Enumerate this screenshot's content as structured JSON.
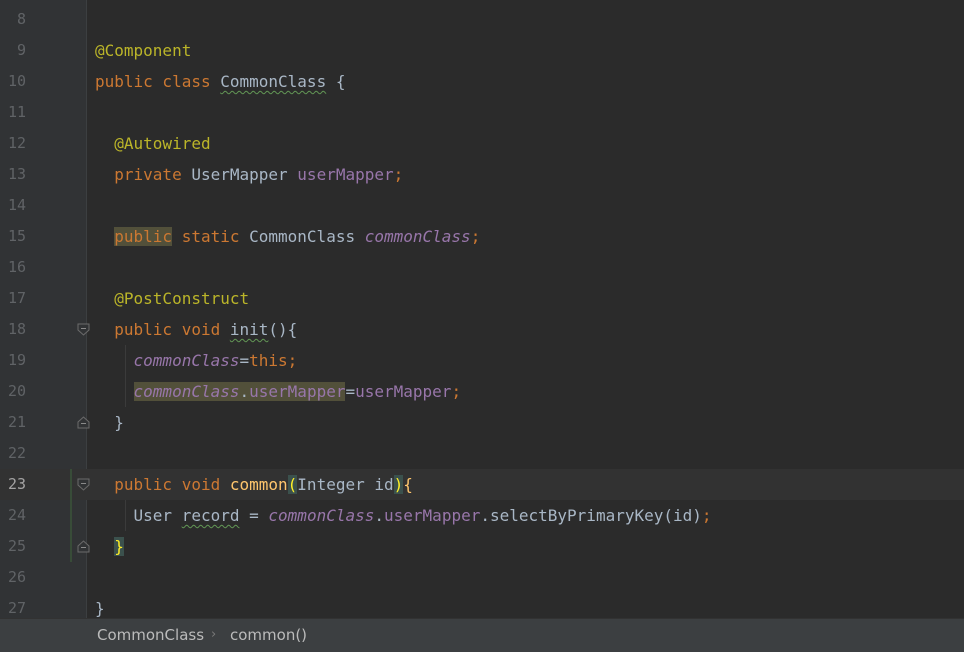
{
  "editor": {
    "lines": [
      {
        "n": "8",
        "tokens": []
      },
      {
        "n": "9",
        "tokens": [
          {
            "t": "@Component",
            "c": "ann"
          }
        ]
      },
      {
        "n": "10",
        "tokens": [
          {
            "t": "public class ",
            "c": "kw"
          },
          {
            "t": "CommonClass",
            "c": "typo"
          },
          {
            "t": " {",
            "c": ""
          }
        ]
      },
      {
        "n": "11",
        "tokens": []
      },
      {
        "n": "12",
        "tokens": [
          {
            "t": "  ",
            "c": ""
          },
          {
            "t": "@Autowired",
            "c": "ann"
          }
        ]
      },
      {
        "n": "13",
        "tokens": [
          {
            "t": "  ",
            "c": ""
          },
          {
            "t": "private ",
            "c": "kw"
          },
          {
            "t": "UserMapper ",
            "c": ""
          },
          {
            "t": "userMapper",
            "c": "fld"
          },
          {
            "t": ";",
            "c": "pun"
          }
        ]
      },
      {
        "n": "14",
        "tokens": []
      },
      {
        "n": "15",
        "tokens": [
          {
            "t": "  ",
            "c": ""
          },
          {
            "t": "public",
            "c": "kw hl-usage"
          },
          {
            "t": " static ",
            "c": "kw"
          },
          {
            "t": "CommonClass ",
            "c": ""
          },
          {
            "t": "commonClass",
            "c": "sfld"
          },
          {
            "t": ";",
            "c": "pun"
          }
        ]
      },
      {
        "n": "16",
        "tokens": []
      },
      {
        "n": "17",
        "tokens": [
          {
            "t": "  ",
            "c": ""
          },
          {
            "t": "@PostConstruct",
            "c": "ann"
          }
        ]
      },
      {
        "n": "18",
        "tokens": [
          {
            "t": "  ",
            "c": ""
          },
          {
            "t": "public void ",
            "c": "kw"
          },
          {
            "t": "init",
            "c": "typo"
          },
          {
            "t": "(){",
            "c": ""
          }
        ]
      },
      {
        "n": "19",
        "tokens": [
          {
            "t": "    ",
            "c": ""
          },
          {
            "t": "commonClass",
            "c": "sfld"
          },
          {
            "t": "=",
            "c": ""
          },
          {
            "t": "this",
            "c": "kw"
          },
          {
            "t": ";",
            "c": "pun"
          }
        ]
      },
      {
        "n": "20",
        "tokens": [
          {
            "t": "    ",
            "c": ""
          },
          {
            "t": "commonClass",
            "c": "sfld hl-usage"
          },
          {
            "t": ".",
            "c": "hl-usage"
          },
          {
            "t": "userMapper",
            "c": "fld hl-usage"
          },
          {
            "t": "=",
            "c": ""
          },
          {
            "t": "userMapper",
            "c": "fld"
          },
          {
            "t": ";",
            "c": "pun"
          }
        ]
      },
      {
        "n": "21",
        "tokens": [
          {
            "t": "  }",
            "c": ""
          }
        ]
      },
      {
        "n": "22",
        "tokens": []
      },
      {
        "n": "23",
        "tokens": [
          {
            "t": "  ",
            "c": ""
          },
          {
            "t": "public void ",
            "c": "kw"
          },
          {
            "t": "common",
            "c": "mth"
          },
          {
            "t": "(",
            "c": "hl-brace"
          },
          {
            "t": "Integer id",
            "c": ""
          },
          {
            "t": ")",
            "c": "hl-brace"
          },
          {
            "t": "{",
            "c": "mth"
          }
        ]
      },
      {
        "n": "24",
        "tokens": [
          {
            "t": "    ",
            "c": ""
          },
          {
            "t": "User ",
            "c": ""
          },
          {
            "t": "record",
            "c": "typo"
          },
          {
            "t": " = ",
            "c": ""
          },
          {
            "t": "commonClass",
            "c": "sfld"
          },
          {
            "t": ".",
            "c": ""
          },
          {
            "t": "userMapper",
            "c": "fld"
          },
          {
            "t": ".selectByPrimaryKey(id)",
            "c": ""
          },
          {
            "t": ";",
            "c": "pun"
          }
        ]
      },
      {
        "n": "25",
        "tokens": [
          {
            "t": "  ",
            "c": ""
          },
          {
            "t": "}",
            "c": "hl-brace"
          }
        ]
      },
      {
        "n": "26",
        "tokens": []
      },
      {
        "n": "27",
        "tokens": [
          {
            "t": "}",
            "c": ""
          }
        ]
      }
    ],
    "current_line": "23",
    "fold_markers": [
      "18",
      "21",
      "23",
      "25"
    ]
  },
  "breadcrumb": {
    "items": [
      "CommonClass",
      "common()"
    ],
    "separator": "›"
  },
  "colors": {
    "background": "#2b2b2b",
    "keyword": "#cc7832",
    "annotation": "#bbb529",
    "field": "#9876aa",
    "method": "#ffc66d",
    "text": "#a9b7c6"
  }
}
